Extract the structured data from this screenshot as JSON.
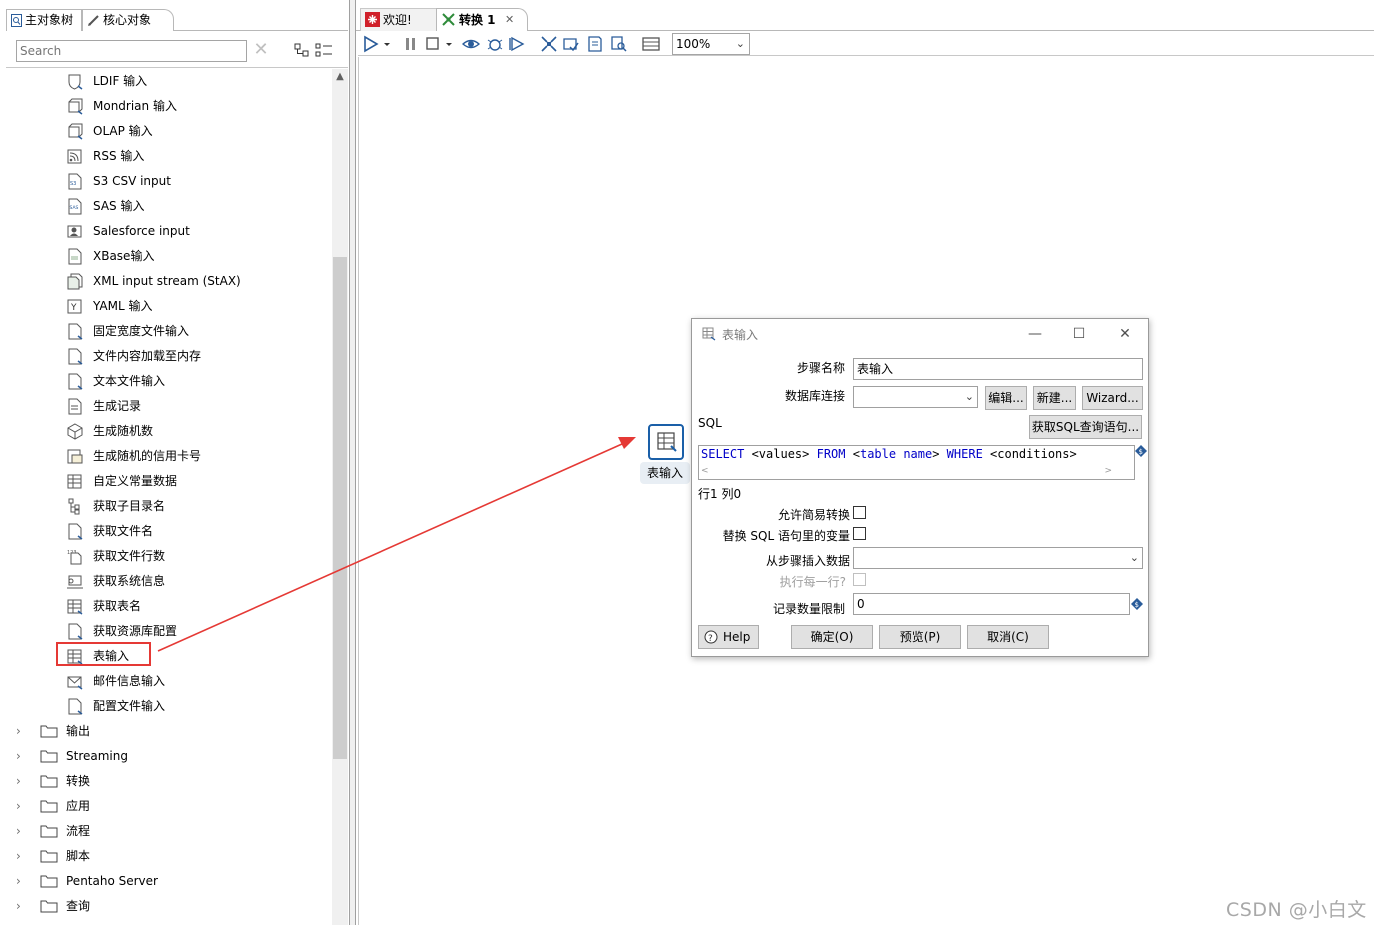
{
  "left_panel": {
    "tabs": [
      {
        "label": "主对象树"
      },
      {
        "label": "核心对象"
      }
    ],
    "search": {
      "value": "",
      "placeholder": "Search"
    },
    "tree_items": [
      {
        "label": "LDIF 输入",
        "icon": "shield-file-icon"
      },
      {
        "label": "Mondrian 输入",
        "icon": "cube-input-icon"
      },
      {
        "label": "OLAP 输入",
        "icon": "cube-input-icon"
      },
      {
        "label": "RSS 输入",
        "icon": "rss-icon"
      },
      {
        "label": "S3 CSV input",
        "icon": "s3-file-icon"
      },
      {
        "label": "SAS 输入",
        "icon": "sas-file-icon"
      },
      {
        "label": "Salesforce input",
        "icon": "salesforce-icon"
      },
      {
        "label": "XBase输入",
        "icon": "dbf-file-icon"
      },
      {
        "label": "XML input stream (StAX)",
        "icon": "xml-stream-icon"
      },
      {
        "label": "YAML 输入",
        "icon": "yaml-icon"
      },
      {
        "label": "固定宽度文件输入",
        "icon": "file-icon"
      },
      {
        "label": "文件内容加载至内存",
        "icon": "file-icon"
      },
      {
        "label": "文本文件输入",
        "icon": "file-icon"
      },
      {
        "label": "生成记录",
        "icon": "generate-rows-icon"
      },
      {
        "label": "生成随机数",
        "icon": "dice-icon"
      },
      {
        "label": "生成随机的信用卡号",
        "icon": "credit-card-icon"
      },
      {
        "label": "自定义常量数据",
        "icon": "table-icon"
      },
      {
        "label": "获取子目录名",
        "icon": "folder-tree-icon"
      },
      {
        "label": "获取文件名",
        "icon": "file-icon"
      },
      {
        "label": "获取文件行数",
        "icon": "file-lines-icon"
      },
      {
        "label": "获取系统信息",
        "icon": "system-info-icon"
      },
      {
        "label": "获取表名",
        "icon": "table-icon"
      },
      {
        "label": "获取资源库配置",
        "icon": "file-icon"
      },
      {
        "label": "表输入",
        "icon": "table-input-icon"
      },
      {
        "label": "邮件信息输入",
        "icon": "mail-icon"
      },
      {
        "label": "配置文件输入",
        "icon": "file-icon"
      }
    ],
    "categories": [
      {
        "label": "输出"
      },
      {
        "label": "Streaming"
      },
      {
        "label": "转换"
      },
      {
        "label": "应用"
      },
      {
        "label": "流程"
      },
      {
        "label": "脚本"
      },
      {
        "label": "Pentaho Server"
      },
      {
        "label": "查询"
      }
    ]
  },
  "editor": {
    "tabs": [
      {
        "label": "欢迎!",
        "icon": "spoon-icon"
      },
      {
        "label": "转换 1",
        "icon": "transformation-icon",
        "close": "✕"
      }
    ],
    "zoom": "100%",
    "step": {
      "label": "表输入"
    }
  },
  "dialog": {
    "title": "表输入",
    "fields": {
      "step_name_label": "步骤名称",
      "step_name_value": "表输入",
      "connection_label": "数据库连接",
      "connection_value": "",
      "edit_button": "编辑...",
      "new_button": "新建...",
      "wizard_button": "Wizard...",
      "sql_label": "SQL",
      "get_sql_button": "获取SQL查询语句...",
      "sql_tokens": [
        {
          "text": "SELECT",
          "kw": true
        },
        {
          "text": " <values> ",
          "kw": false
        },
        {
          "text": "FROM",
          "kw": true
        },
        {
          "text": " <",
          "kw": false
        },
        {
          "text": "table name",
          "kw": true
        },
        {
          "text": "> ",
          "kw": false
        },
        {
          "text": "WHERE",
          "kw": true
        },
        {
          "text": " <conditions>",
          "kw": false
        }
      ],
      "cursor_position": "行1 列0",
      "lazy_conversion_label": "允许简易转换",
      "replace_variables_label": "替换 SQL 语句里的变量",
      "insert_from_step_label": "从步骤插入数据",
      "insert_from_step_value": "",
      "execute_each_row_label": "执行每一行?",
      "limit_label": "记录数量限制",
      "limit_value": "0"
    },
    "buttons": {
      "help": "Help",
      "ok": "确定(O)",
      "preview": "预览(P)",
      "cancel": "取消(C)"
    }
  },
  "watermark": "CSDN @小白文",
  "colors": {
    "highlight": "#e53935",
    "step_border": "#1a5fa8",
    "sql_keyword": "#0000c8"
  }
}
